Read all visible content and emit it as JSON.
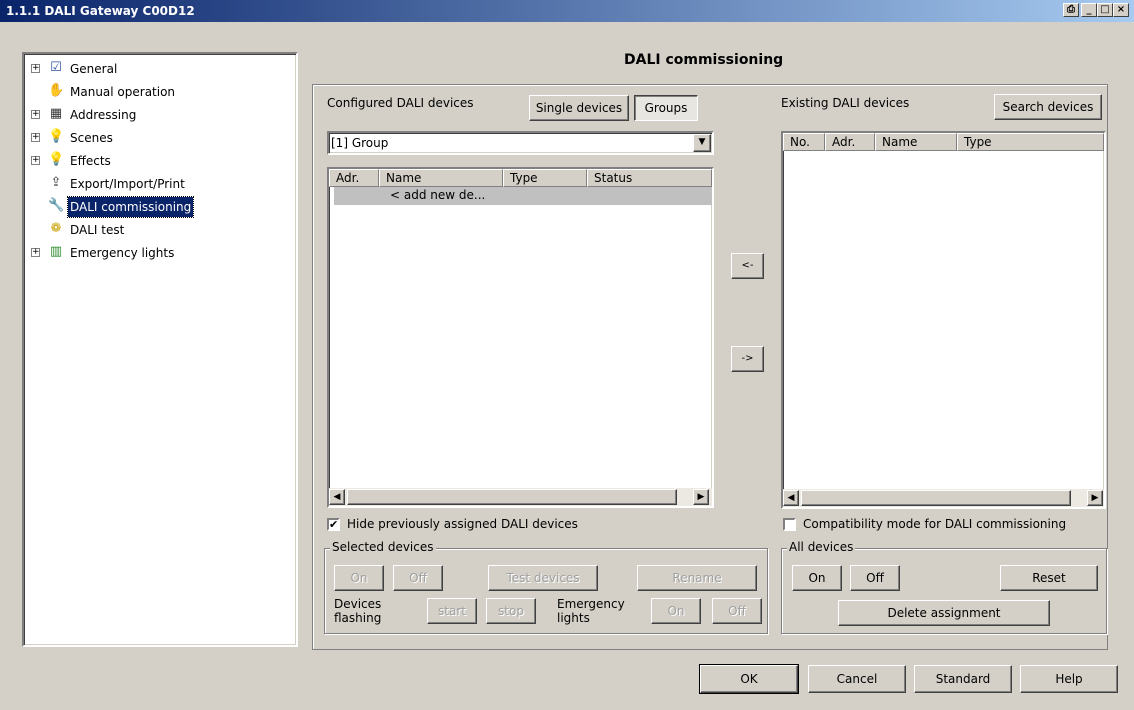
{
  "window": {
    "title": "1.1.1 DALI Gateway C00D12"
  },
  "tree": {
    "items": [
      {
        "label": "General",
        "expandable": true,
        "icon": "checklist-icon"
      },
      {
        "label": "Manual operation",
        "expandable": false,
        "icon": "hand-icon"
      },
      {
        "label": "Addressing",
        "expandable": true,
        "icon": "grid-icon"
      },
      {
        "label": "Scenes",
        "expandable": true,
        "icon": "bulb-icon"
      },
      {
        "label": "Effects",
        "expandable": true,
        "icon": "bulb-icon"
      },
      {
        "label": "Export/Import/Print",
        "expandable": false,
        "icon": "export-icon"
      },
      {
        "label": "DALI commissioning",
        "expandable": false,
        "icon": "wrench-icon",
        "selected": true
      },
      {
        "label": "DALI test",
        "expandable": false,
        "icon": "gear-icon"
      },
      {
        "label": "Emergency lights",
        "expandable": true,
        "icon": "emergency-light-icon"
      }
    ]
  },
  "main": {
    "heading": "DALI commissioning",
    "configured_label": "Configured DALI devices",
    "single_devices_label": "Single devices",
    "groups_label": "Groups",
    "group_select_value": "[1] Group",
    "configured_columns": [
      "Adr.",
      "Name",
      "Type",
      "Status"
    ],
    "configured_rows": [
      {
        "adr": "",
        "name": "< add new de...",
        "type": "",
        "status": ""
      }
    ],
    "move_left_label": "<-",
    "move_right_label": "->",
    "existing_label": "Existing DALI devices",
    "search_devices_label": "Search devices",
    "existing_columns": [
      "No.",
      "Adr.",
      "Name",
      "Type"
    ],
    "hide_assigned_label": "Hide previously assigned DALI devices",
    "hide_assigned_checked": true,
    "compat_mode_label": "Compatibility mode for DALI commissioning",
    "compat_mode_checked": false
  },
  "selected_devices": {
    "title": "Selected devices",
    "on_label": "On",
    "off_label": "Off",
    "test_devices_label": "Test devices",
    "rename_label": "Rename",
    "devices_flashing_label": "Devices flashing",
    "start_label": "start",
    "stop_label": "stop",
    "emergency_lights_label": "Emergency lights",
    "emergency_on_label": "On",
    "emergency_off_label": "Off"
  },
  "all_devices": {
    "title": "All devices",
    "on_label": "On",
    "off_label": "Off",
    "reset_label": "Reset",
    "delete_assignment_label": "Delete assignment"
  },
  "footer": {
    "ok_label": "OK",
    "cancel_label": "Cancel",
    "standard_label": "Standard",
    "help_label": "Help"
  },
  "colors": {
    "titlebar_start": "#0a246a",
    "titlebar_end": "#a6caf0",
    "face": "#d4d0c8",
    "selection": "#0a246a",
    "list_selection": "#c0c0c0"
  }
}
